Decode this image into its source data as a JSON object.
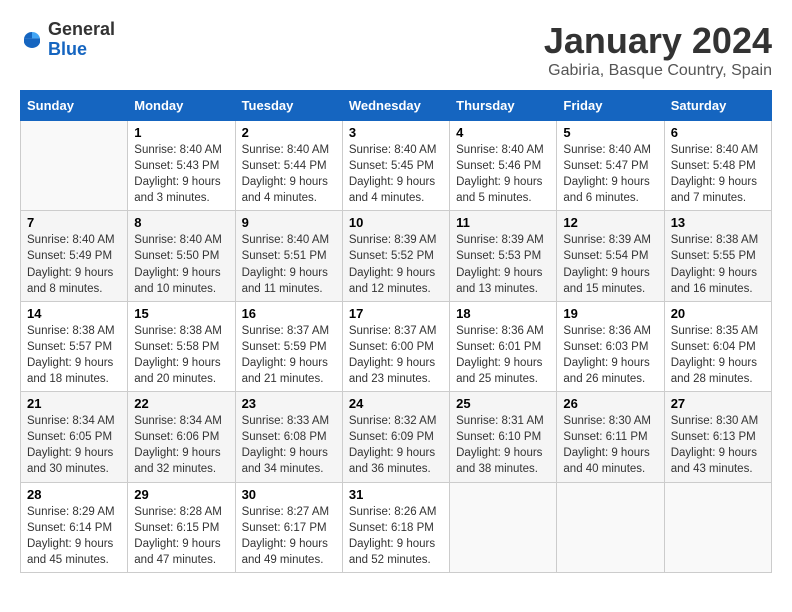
{
  "header": {
    "logo_general": "General",
    "logo_blue": "Blue",
    "main_title": "January 2024",
    "subtitle": "Gabiria, Basque Country, Spain"
  },
  "calendar": {
    "days_of_week": [
      "Sunday",
      "Monday",
      "Tuesday",
      "Wednesday",
      "Thursday",
      "Friday",
      "Saturday"
    ],
    "weeks": [
      [
        {
          "day": "",
          "info": ""
        },
        {
          "day": "1",
          "info": "Sunrise: 8:40 AM\nSunset: 5:43 PM\nDaylight: 9 hours\nand 3 minutes."
        },
        {
          "day": "2",
          "info": "Sunrise: 8:40 AM\nSunset: 5:44 PM\nDaylight: 9 hours\nand 4 minutes."
        },
        {
          "day": "3",
          "info": "Sunrise: 8:40 AM\nSunset: 5:45 PM\nDaylight: 9 hours\nand 4 minutes."
        },
        {
          "day": "4",
          "info": "Sunrise: 8:40 AM\nSunset: 5:46 PM\nDaylight: 9 hours\nand 5 minutes."
        },
        {
          "day": "5",
          "info": "Sunrise: 8:40 AM\nSunset: 5:47 PM\nDaylight: 9 hours\nand 6 minutes."
        },
        {
          "day": "6",
          "info": "Sunrise: 8:40 AM\nSunset: 5:48 PM\nDaylight: 9 hours\nand 7 minutes."
        }
      ],
      [
        {
          "day": "7",
          "info": "Sunrise: 8:40 AM\nSunset: 5:49 PM\nDaylight: 9 hours\nand 8 minutes."
        },
        {
          "day": "8",
          "info": "Sunrise: 8:40 AM\nSunset: 5:50 PM\nDaylight: 9 hours\nand 10 minutes."
        },
        {
          "day": "9",
          "info": "Sunrise: 8:40 AM\nSunset: 5:51 PM\nDaylight: 9 hours\nand 11 minutes."
        },
        {
          "day": "10",
          "info": "Sunrise: 8:39 AM\nSunset: 5:52 PM\nDaylight: 9 hours\nand 12 minutes."
        },
        {
          "day": "11",
          "info": "Sunrise: 8:39 AM\nSunset: 5:53 PM\nDaylight: 9 hours\nand 13 minutes."
        },
        {
          "day": "12",
          "info": "Sunrise: 8:39 AM\nSunset: 5:54 PM\nDaylight: 9 hours\nand 15 minutes."
        },
        {
          "day": "13",
          "info": "Sunrise: 8:38 AM\nSunset: 5:55 PM\nDaylight: 9 hours\nand 16 minutes."
        }
      ],
      [
        {
          "day": "14",
          "info": "Sunrise: 8:38 AM\nSunset: 5:57 PM\nDaylight: 9 hours\nand 18 minutes."
        },
        {
          "day": "15",
          "info": "Sunrise: 8:38 AM\nSunset: 5:58 PM\nDaylight: 9 hours\nand 20 minutes."
        },
        {
          "day": "16",
          "info": "Sunrise: 8:37 AM\nSunset: 5:59 PM\nDaylight: 9 hours\nand 21 minutes."
        },
        {
          "day": "17",
          "info": "Sunrise: 8:37 AM\nSunset: 6:00 PM\nDaylight: 9 hours\nand 23 minutes."
        },
        {
          "day": "18",
          "info": "Sunrise: 8:36 AM\nSunset: 6:01 PM\nDaylight: 9 hours\nand 25 minutes."
        },
        {
          "day": "19",
          "info": "Sunrise: 8:36 AM\nSunset: 6:03 PM\nDaylight: 9 hours\nand 26 minutes."
        },
        {
          "day": "20",
          "info": "Sunrise: 8:35 AM\nSunset: 6:04 PM\nDaylight: 9 hours\nand 28 minutes."
        }
      ],
      [
        {
          "day": "21",
          "info": "Sunrise: 8:34 AM\nSunset: 6:05 PM\nDaylight: 9 hours\nand 30 minutes."
        },
        {
          "day": "22",
          "info": "Sunrise: 8:34 AM\nSunset: 6:06 PM\nDaylight: 9 hours\nand 32 minutes."
        },
        {
          "day": "23",
          "info": "Sunrise: 8:33 AM\nSunset: 6:08 PM\nDaylight: 9 hours\nand 34 minutes."
        },
        {
          "day": "24",
          "info": "Sunrise: 8:32 AM\nSunset: 6:09 PM\nDaylight: 9 hours\nand 36 minutes."
        },
        {
          "day": "25",
          "info": "Sunrise: 8:31 AM\nSunset: 6:10 PM\nDaylight: 9 hours\nand 38 minutes."
        },
        {
          "day": "26",
          "info": "Sunrise: 8:30 AM\nSunset: 6:11 PM\nDaylight: 9 hours\nand 40 minutes."
        },
        {
          "day": "27",
          "info": "Sunrise: 8:30 AM\nSunset: 6:13 PM\nDaylight: 9 hours\nand 43 minutes."
        }
      ],
      [
        {
          "day": "28",
          "info": "Sunrise: 8:29 AM\nSunset: 6:14 PM\nDaylight: 9 hours\nand 45 minutes."
        },
        {
          "day": "29",
          "info": "Sunrise: 8:28 AM\nSunset: 6:15 PM\nDaylight: 9 hours\nand 47 minutes."
        },
        {
          "day": "30",
          "info": "Sunrise: 8:27 AM\nSunset: 6:17 PM\nDaylight: 9 hours\nand 49 minutes."
        },
        {
          "day": "31",
          "info": "Sunrise: 8:26 AM\nSunset: 6:18 PM\nDaylight: 9 hours\nand 52 minutes."
        },
        {
          "day": "",
          "info": ""
        },
        {
          "day": "",
          "info": ""
        },
        {
          "day": "",
          "info": ""
        }
      ]
    ]
  }
}
